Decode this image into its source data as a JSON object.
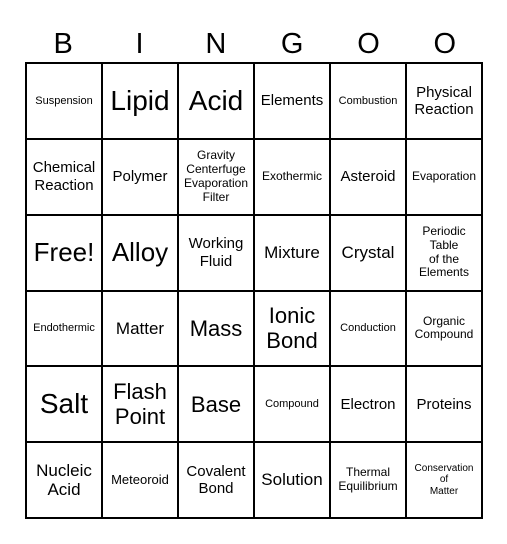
{
  "header": [
    "B",
    "I",
    "N",
    "G",
    "O",
    "O"
  ],
  "cells": [
    [
      "Suspension",
      "Lipid",
      "Acid",
      "Elements",
      "Combustion",
      "Physical\nReaction"
    ],
    [
      "Chemical\nReaction",
      "Polymer",
      "Gravity\nCenterfuge\nEvaporation\nFilter",
      "Exothermic",
      "Asteroid",
      "Evaporation"
    ],
    [
      "Free!",
      "Alloy",
      "Working\nFluid",
      "Mixture",
      "Crystal",
      "Periodic\nTable\nof the\nElements"
    ],
    [
      "Endothermic",
      "Matter",
      "Mass",
      "Ionic\nBond",
      "Conduction",
      "Organic\nCompound"
    ],
    [
      "Salt",
      "Flash\nPoint",
      "Base",
      "Compound",
      "Electron",
      "Proteins"
    ],
    [
      "Nucleic\nAcid",
      "Meteoroid",
      "Covalent\nBond",
      "Solution",
      "Thermal\nEquilibrium",
      "Conservation\nof\nMatter"
    ]
  ]
}
